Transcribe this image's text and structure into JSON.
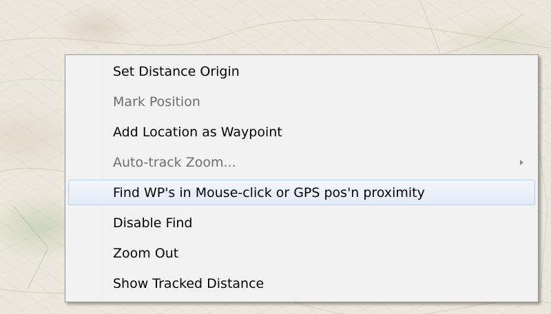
{
  "context_menu": {
    "items": [
      {
        "label": "Set Distance Origin",
        "state": "normal"
      },
      {
        "label": "Mark Position",
        "state": "disabled"
      },
      {
        "label": "Add Location as Waypoint",
        "state": "normal"
      },
      {
        "label": "Auto-track Zoom...",
        "state": "disabled",
        "submenu": true
      },
      {
        "label": "Find WP's in Mouse-click or GPS pos'n proximity",
        "state": "highlighted"
      },
      {
        "label": "Disable Find",
        "state": "normal"
      },
      {
        "label": "Zoom Out",
        "state": "normal"
      },
      {
        "label": "Show Tracked Distance",
        "state": "normal"
      }
    ],
    "submenu_icon": "chevron-right-icon"
  },
  "colors": {
    "menu_background": "#f2f2f2",
    "menu_border": "#979797",
    "highlight_border": "#aecff7",
    "disabled_text": "#6d6d6d"
  }
}
